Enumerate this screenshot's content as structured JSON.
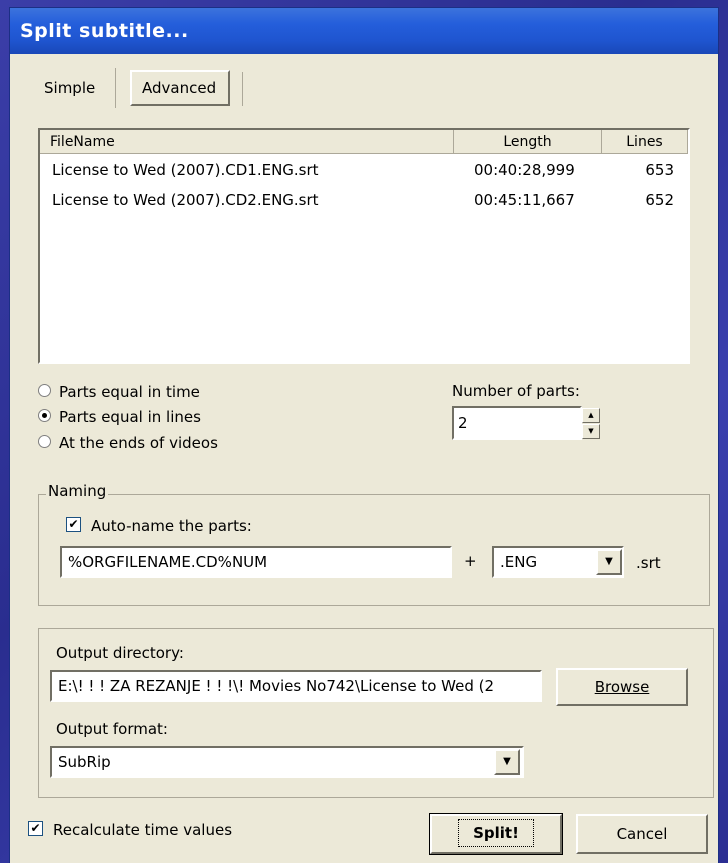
{
  "window": {
    "title": "Split subtitle..."
  },
  "tabs": [
    {
      "label": "Simple",
      "active": false
    },
    {
      "label": "Advanced",
      "active": true
    }
  ],
  "file_list": {
    "columns": [
      "FileName",
      "Length",
      "Lines"
    ],
    "rows": [
      {
        "name": "License to Wed (2007).CD1.ENG.srt",
        "length": "00:40:28,999",
        "lines": "653"
      },
      {
        "name": "License to Wed (2007).CD2.ENG.srt",
        "length": "00:45:11,667",
        "lines": "652"
      }
    ]
  },
  "split_mode": {
    "options": [
      "Parts equal in time",
      "Parts equal in lines",
      "At the ends of videos"
    ],
    "selected": "Parts equal in lines"
  },
  "parts": {
    "label": "Number of parts:",
    "value": "2"
  },
  "naming": {
    "group_label": "Naming",
    "auto_name_label": "Auto-name the parts:",
    "auto_name_checked": true,
    "pattern": "%ORGFILENAME.CD%NUM",
    "plus": "+",
    "suffix": ".ENG",
    "extension": ".srt"
  },
  "output": {
    "dir_label": "Output directory:",
    "dir_value": "E:\\! ! ! ZA REZANJE ! ! !\\! Movies No742\\License to Wed (2",
    "browse_label": "Browse",
    "format_label": "Output format:",
    "format_value": "SubRip"
  },
  "footer": {
    "recalc_label": "Recalculate time values",
    "recalc_checked": true,
    "split_label": "Split!",
    "cancel_label": "Cancel"
  },
  "colors": {
    "titlebar": "#245edb",
    "dialog_bg": "#ece9d8",
    "desktop": "#2f3298"
  }
}
